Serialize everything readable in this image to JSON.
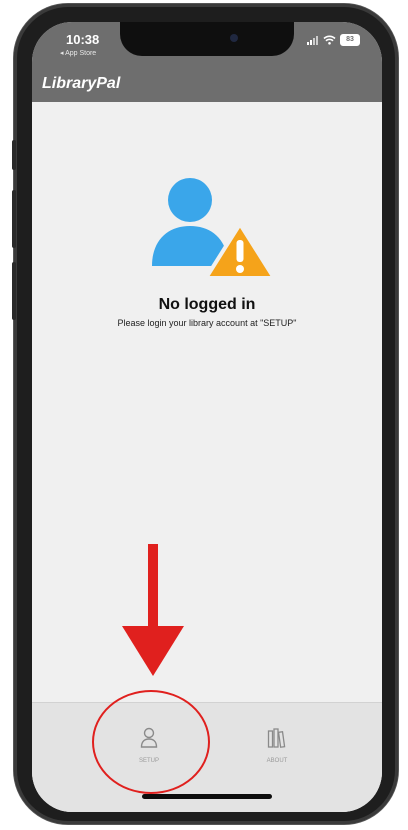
{
  "status_bar": {
    "time": "10:38",
    "back_app": "◂ App Store",
    "battery": "83"
  },
  "header": {
    "title": "LibraryPal"
  },
  "empty_state": {
    "icon": "user-warning-icon",
    "title": "No logged in",
    "subtitle": "Please login your library account at \"SETUP\""
  },
  "tabs": [
    {
      "label": "SETUP",
      "icon": "person-icon"
    },
    {
      "label": "ABOUT",
      "icon": "books-icon"
    }
  ],
  "annotations": {
    "arrow_color": "#e0201e",
    "circle_color": "#e0201e"
  },
  "colors": {
    "header_bg": "#6e6e6e",
    "user_icon_blue": "#3aa6ea",
    "warning_orange": "#f5a31a"
  }
}
